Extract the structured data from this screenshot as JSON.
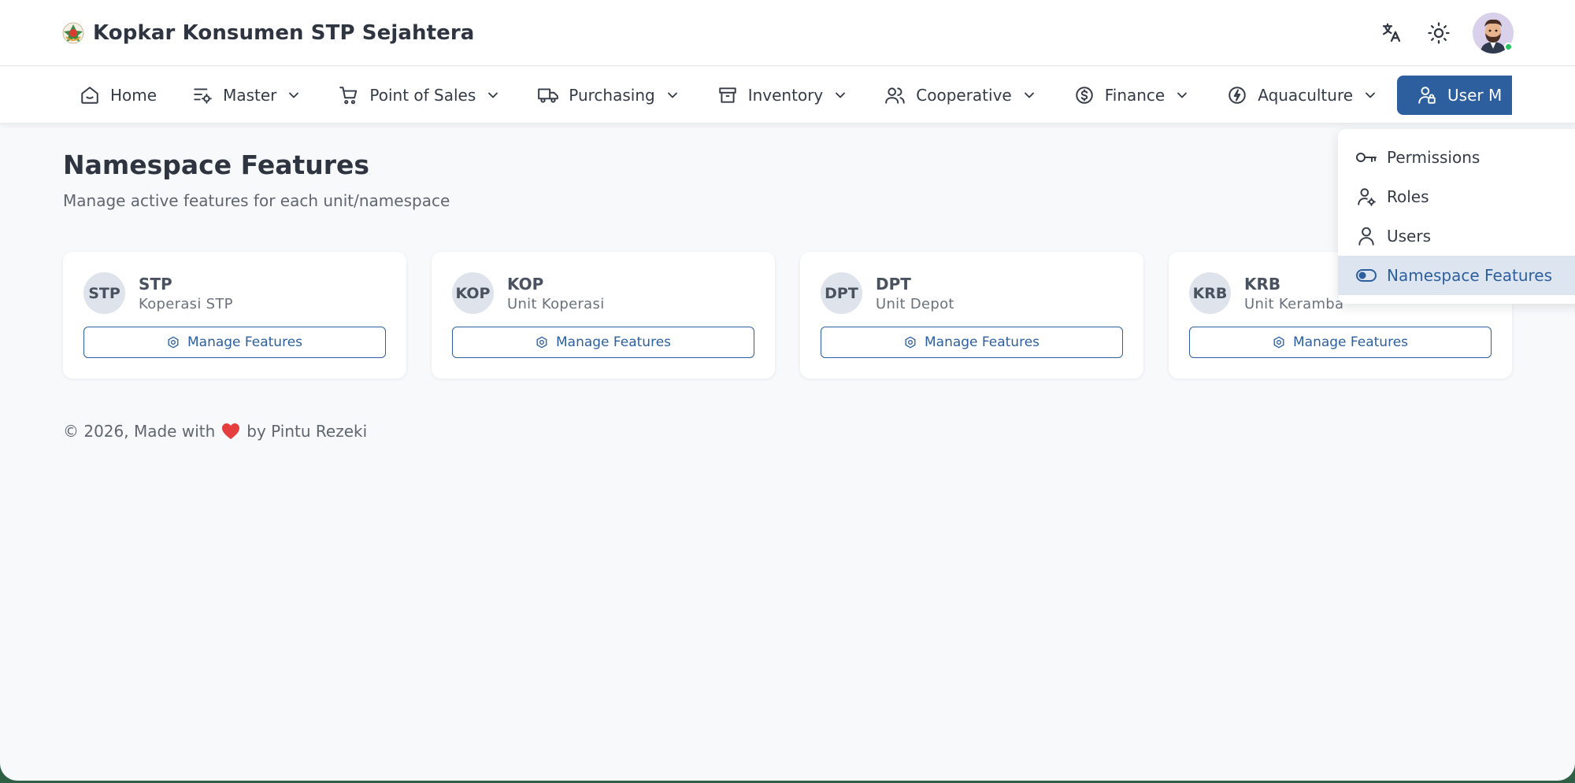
{
  "app": {
    "title": "Kopkar Konsumen STP Sejahtera"
  },
  "header": {
    "actions": [
      {
        "icon": "translate-icon"
      },
      {
        "icon": "sun-icon"
      },
      {
        "icon": "avatar"
      }
    ]
  },
  "nav": {
    "items": [
      {
        "label": "Home",
        "icon": "home-icon",
        "dropdown": false
      },
      {
        "label": "Master",
        "icon": "sliders-gear-icon",
        "dropdown": true
      },
      {
        "label": "Point of Sales",
        "icon": "cart-icon",
        "dropdown": true
      },
      {
        "label": "Purchasing",
        "icon": "truck-icon",
        "dropdown": true
      },
      {
        "label": "Inventory",
        "icon": "archive-icon",
        "dropdown": true
      },
      {
        "label": "Cooperative",
        "icon": "users-icon",
        "dropdown": true
      },
      {
        "label": "Finance",
        "icon": "coin-icon",
        "dropdown": true
      },
      {
        "label": "Aquaculture",
        "icon": "bolt-icon",
        "dropdown": true
      },
      {
        "label": "User M",
        "icon": "user-lock-icon",
        "dropdown": false,
        "active": true
      }
    ]
  },
  "page": {
    "title": "Namespace Features",
    "subtitle": "Manage active features for each unit/namespace"
  },
  "cards": [
    {
      "badge": "STP",
      "code": "STP",
      "name": "Koperasi STP",
      "button": "Manage Features"
    },
    {
      "badge": "KOP",
      "code": "KOP",
      "name": "Unit Koperasi",
      "button": "Manage Features"
    },
    {
      "badge": "DPT",
      "code": "DPT",
      "name": "Unit Depot",
      "button": "Manage Features"
    },
    {
      "badge": "KRB",
      "code": "KRB",
      "name": "Unit Keramba",
      "button": "Manage Features"
    }
  ],
  "footer": {
    "prefix": "© 2026, Made with",
    "suffix": "by Pintu Rezeki"
  },
  "dropdown": {
    "items": [
      {
        "label": "Permissions",
        "icon": "key-icon"
      },
      {
        "label": "Roles",
        "icon": "user-gear-icon"
      },
      {
        "label": "Users",
        "icon": "user-icon"
      },
      {
        "label": "Namespace Features",
        "icon": "toggle-icon",
        "active": true
      }
    ]
  },
  "colors": {
    "primary": "#2d5f9e",
    "heart": "#e53e3e",
    "online": "#22c55e"
  }
}
